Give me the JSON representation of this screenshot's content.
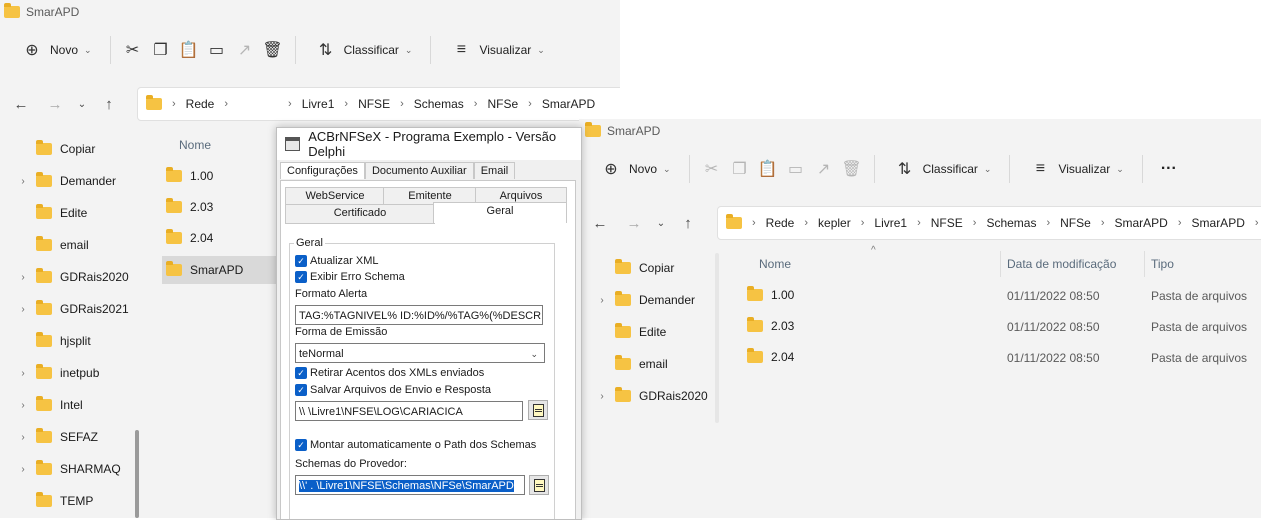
{
  "explorer_left": {
    "title": "SmarAPD",
    "toolbar": {
      "new_label": "Novo",
      "sort_label": "Classificar",
      "view_label": "Visualizar"
    },
    "breadcrumb": [
      "Rede",
      "Livre1",
      "NFSE",
      "Schemas",
      "NFSe",
      "SmarAPD"
    ],
    "sidebar": [
      {
        "label": "Copiar",
        "expandable": false
      },
      {
        "label": "Demander",
        "expandable": true
      },
      {
        "label": "Edite",
        "expandable": false
      },
      {
        "label": "email",
        "expandable": false
      },
      {
        "label": "GDRais2020",
        "expandable": true
      },
      {
        "label": "GDRais2021",
        "expandable": true
      },
      {
        "label": "hjsplit",
        "expandable": false
      },
      {
        "label": "inetpub",
        "expandable": true
      },
      {
        "label": "Intel",
        "expandable": true
      },
      {
        "label": "SEFAZ",
        "expandable": true
      },
      {
        "label": "SHARMAQ",
        "expandable": true
      },
      {
        "label": "TEMP",
        "expandable": false
      }
    ],
    "column_name": "Nome",
    "files": [
      "1.00",
      "2.03",
      "2.04",
      "SmarAPD"
    ]
  },
  "dialog": {
    "title": "ACBrNFSeX - Programa Exemplo - Versão Delphi",
    "tabs": [
      "Configurações",
      "Documento Auxiliar",
      "Email"
    ],
    "subtabs_row1": [
      "WebService",
      "Emitente",
      "Arquivos"
    ],
    "subtabs_row2": [
      "Certificado",
      "Geral"
    ],
    "group_label": "Geral",
    "chk_atualizar_xml": "Atualizar XML",
    "chk_exibir_erro": "Exibir Erro Schema",
    "formato_alerta_label": "Formato Alerta",
    "formato_alerta_value": "TAG:%TAGNIVEL% ID:%ID%/%TAG%(%DESCRI",
    "forma_emissao_label": "Forma de Emissão",
    "forma_emissao_value": "teNormal",
    "chk_retirar_acentos": "Retirar Acentos dos XMLs enviados",
    "chk_salvar_arquivos": "Salvar Arquivos de Envio e Resposta",
    "log_path": "\\\\        \\Livre1\\NFSE\\LOG\\CARIACICA",
    "chk_montar_path": "Montar automaticamente o Path dos Schemas",
    "schemas_label": "Schemas do Provedor:",
    "schemas_path": "\\\\'    .       \\Livre1\\NFSE\\Schemas\\NFSe\\SmarAPD"
  },
  "explorer_right": {
    "title": "SmarAPD",
    "toolbar": {
      "new_label": "Novo",
      "sort_label": "Classificar",
      "view_label": "Visualizar",
      "more": "···"
    },
    "breadcrumb": [
      "Rede",
      "kepler",
      "Livre1",
      "NFSE",
      "Schemas",
      "NFSe",
      "SmarAPD",
      "SmarAPD"
    ],
    "sidebar": [
      {
        "label": "Copiar",
        "expandable": false
      },
      {
        "label": "Demander",
        "expandable": true
      },
      {
        "label": "Edite",
        "expandable": false
      },
      {
        "label": "email",
        "expandable": false
      },
      {
        "label": "GDRais2020",
        "expandable": true
      }
    ],
    "columns": {
      "name": "Nome",
      "date": "Data de modificação",
      "type": "Tipo"
    },
    "files": [
      {
        "name": "1.00",
        "date": "01/11/2022 08:50",
        "type": "Pasta de arquivos"
      },
      {
        "name": "2.03",
        "date": "01/11/2022 08:50",
        "type": "Pasta de arquivos"
      },
      {
        "name": "2.04",
        "date": "01/11/2022 08:50",
        "type": "Pasta de arquivos"
      }
    ]
  }
}
